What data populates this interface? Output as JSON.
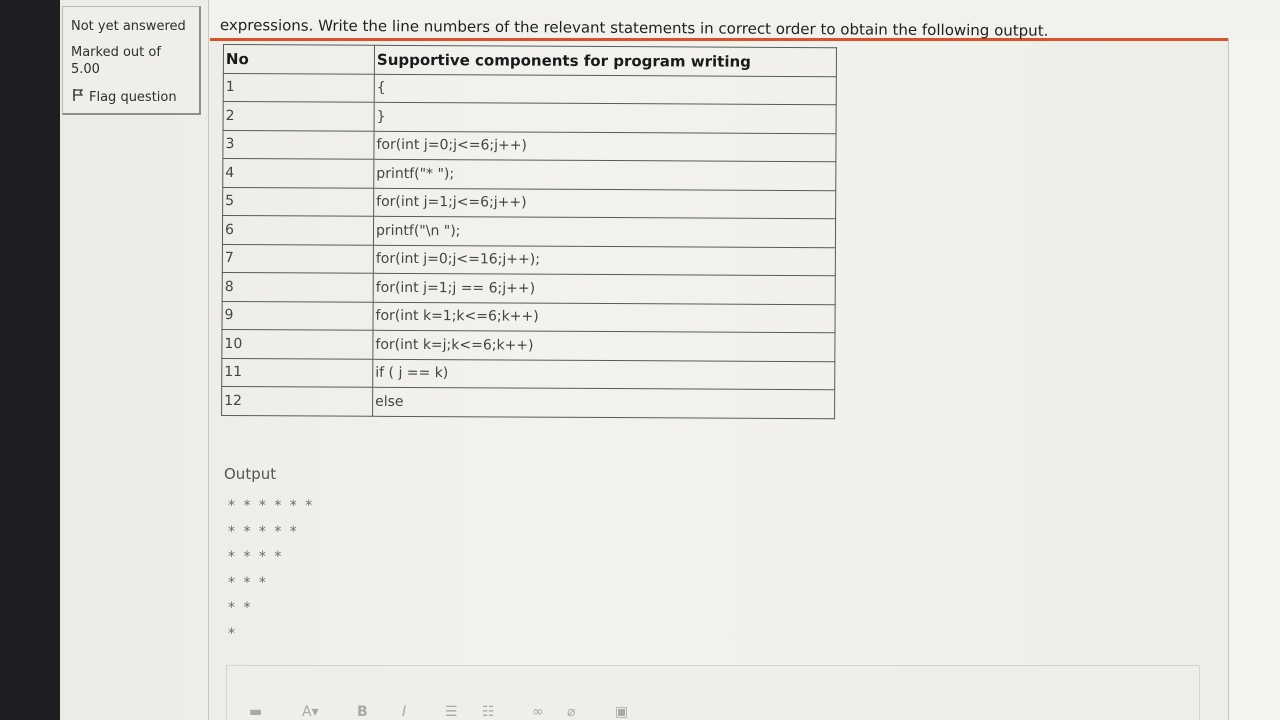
{
  "info": {
    "status": "Not yet answered",
    "marked_out_of": "Marked out of 5.00",
    "flag_label": "Flag question",
    "flag_icon": "flag-icon"
  },
  "question": {
    "text": "expressions. Write the line numbers of the relevant statements in correct order to obtain the following output."
  },
  "table": {
    "headers": [
      "No",
      "Supportive components for program writing"
    ],
    "rows": [
      {
        "no": "1",
        "code": "{"
      },
      {
        "no": "2",
        "code": "}"
      },
      {
        "no": "3",
        "code": "for(int  j=0;j<=6;j++)"
      },
      {
        "no": "4",
        "code": "printf(\"* \");"
      },
      {
        "no": "5",
        "code": "for(int j=1;j<=6;j++)"
      },
      {
        "no": "6",
        "code": "printf(\"\\n \");"
      },
      {
        "no": "7",
        "code": "for(int j=0;j<=16;j++);"
      },
      {
        "no": "8",
        "code": "for(int j=1;j == 6;j++)"
      },
      {
        "no": "9",
        "code": "for(int k=1;k<=6;k++)"
      },
      {
        "no": "10",
        "code": "for(int k=j;k<=6;k++)"
      },
      {
        "no": "11",
        "code": "if ( j == k)"
      },
      {
        "no": "12",
        "code": "else"
      }
    ]
  },
  "output": {
    "label": "Output",
    "lines": [
      "* * * * * *",
      "* * * * *",
      "* * * *",
      "* * *",
      "* *",
      "*"
    ]
  },
  "toolbar": {
    "icons": [
      "paragraph-icon",
      "font-size-icon",
      "bold-icon",
      "italic-icon",
      "bullet-list-icon",
      "numbered-list-icon",
      "link-icon",
      "unlink-icon",
      "image-icon"
    ]
  },
  "colors": {
    "accent": "#d8532a",
    "background": "#efeee9"
  }
}
